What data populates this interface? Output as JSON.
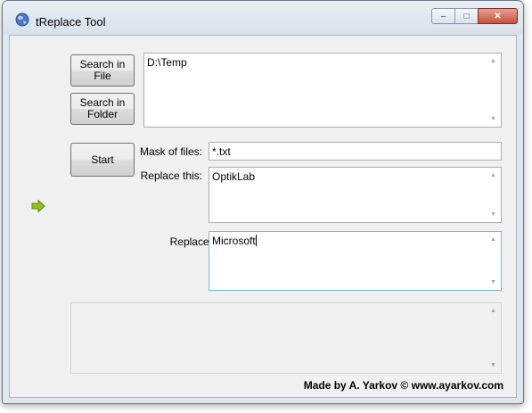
{
  "window": {
    "title": "tReplace Tool",
    "controls": {
      "minimize": "–",
      "maximize": "□",
      "close": "✕"
    }
  },
  "buttons": {
    "search_file": "Search in File",
    "search_folder": "Search in Folder",
    "start": "Start"
  },
  "fields": {
    "path_value": "D:\\Temp",
    "mask_label": "Mask of files:",
    "mask_value": "*.txt",
    "replace_this_label": "Replace this:",
    "replace_this_value": "OptikLab",
    "replace_by_label": "Replace by:",
    "replace_by_value": "Microsoft",
    "log_value": ""
  },
  "footer": {
    "credit": "Made by A. Yarkov © www.ayarkov.com"
  },
  "icons": {
    "app": "globe-icon",
    "indicator": "green-arrow-right-icon"
  },
  "colors": {
    "arrow": "#8dc21f"
  }
}
